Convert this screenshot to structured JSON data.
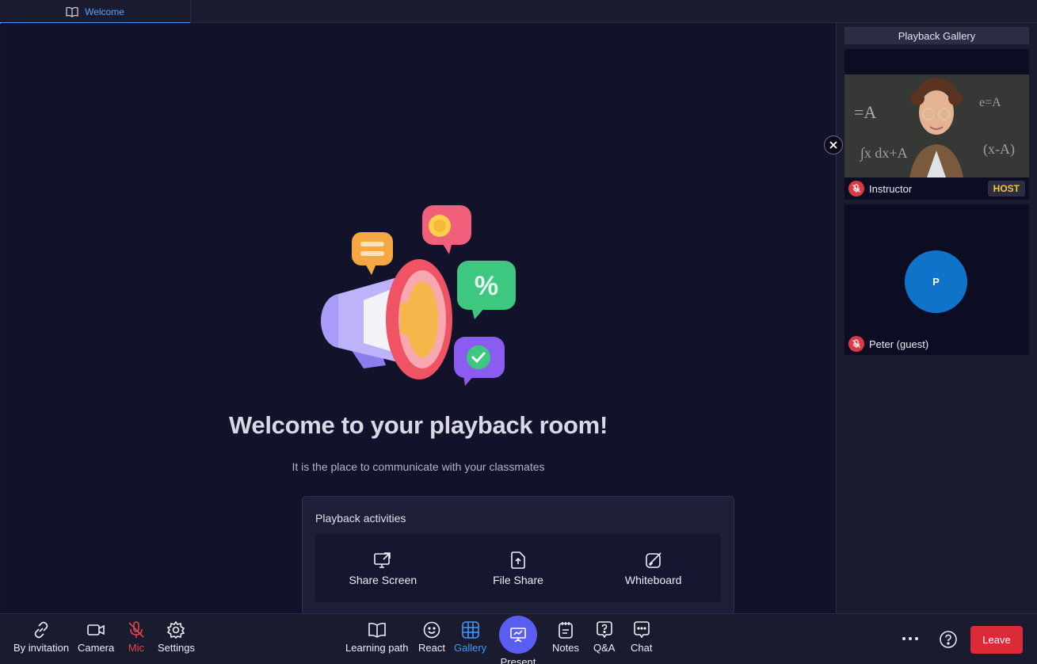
{
  "tab": {
    "label": "Welcome",
    "icon": "book-open-icon"
  },
  "stage": {
    "title": "Welcome to your playback room!",
    "subtitle": "It is the place to communicate with your classmates"
  },
  "activities": {
    "title": "Playback activities",
    "items": [
      {
        "label": "Share Screen",
        "icon": "share-screen-icon"
      },
      {
        "label": "File Share",
        "icon": "file-share-icon"
      },
      {
        "label": "Whiteboard",
        "icon": "whiteboard-icon"
      }
    ]
  },
  "gallery": {
    "title": "Playback Gallery",
    "participants": [
      {
        "name": "Instructor",
        "badge": "HOST",
        "mic": "muted"
      },
      {
        "name": "Peter (guest)",
        "initial": "P",
        "mic": "muted"
      }
    ]
  },
  "toolbar": {
    "invite": "By invitation",
    "camera": "Camera",
    "mic": "Mic",
    "settings": "Settings",
    "learning_path": "Learning path",
    "react": "React",
    "gallery": "Gallery",
    "present": "Present",
    "notes": "Notes",
    "qa": "Q&A",
    "chat": "Chat",
    "leave": "Leave"
  },
  "colors": {
    "accent_blue": "#3d9bff",
    "mic_muted_red": "#e0464f",
    "leave_red": "#db2a38",
    "host_badge": "#f4c542",
    "present_purple": "#5a5ef0"
  }
}
